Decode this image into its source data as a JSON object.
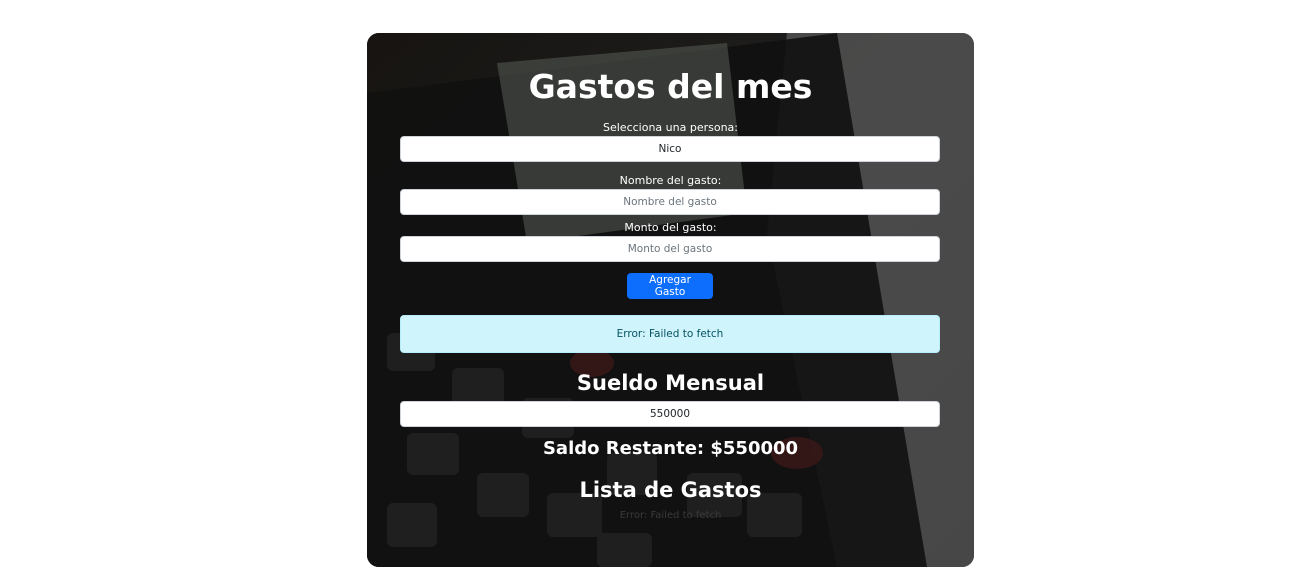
{
  "page": {
    "title": "Gastos del mes"
  },
  "form": {
    "persona_label": "Selecciona una persona:",
    "persona_value": "Nico",
    "nombre_label": "Nombre del gasto:",
    "nombre_placeholder": "Nombre del gasto",
    "monto_label": "Monto del gasto:",
    "monto_placeholder": "Monto del gasto",
    "submit_label": "Agregar Gasto"
  },
  "alert": {
    "message": "Error: Failed to fetch"
  },
  "sueldo": {
    "heading": "Sueldo Mensual",
    "value": "550000"
  },
  "saldo": {
    "text": "Saldo Restante: $550000"
  },
  "lista": {
    "heading": "Lista de Gastos",
    "error": "Error: Failed to fetch"
  },
  "colors": {
    "primary": "#0d6efd",
    "alert_bg": "#cff4fc",
    "alert_text": "#055160"
  },
  "icons": {
    "background": "calculator-photo"
  }
}
